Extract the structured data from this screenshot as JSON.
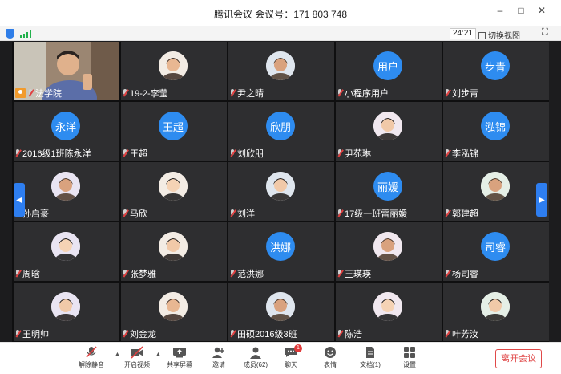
{
  "window": {
    "title": "腾讯会议 会议号：171 803 748",
    "minimize": "–",
    "maximize": "□",
    "close": "✕"
  },
  "infobar": {
    "timer": "24:21",
    "switch_view": "切换视图",
    "fullscreen": "⛶"
  },
  "colors": {
    "accent": "#2e8cf0",
    "leave": "#e04848",
    "tile_bg": "#2e2e30"
  },
  "participants": [
    {
      "name": "法学院",
      "type": "video"
    },
    {
      "name": "19-2-李莹",
      "type": "photo"
    },
    {
      "name": "尹之晴",
      "type": "photo"
    },
    {
      "name": "小程序用户",
      "type": "avatar",
      "avatar": "用户"
    },
    {
      "name": "刘步青",
      "type": "avatar",
      "avatar": "步青"
    },
    {
      "name": "2016级1班陈永洋",
      "type": "avatar",
      "avatar": "永洋"
    },
    {
      "name": "王超",
      "type": "avatar",
      "avatar": "王超"
    },
    {
      "name": "刘欣朋",
      "type": "avatar",
      "avatar": "欣朋"
    },
    {
      "name": "尹苑琳",
      "type": "photo"
    },
    {
      "name": "李泓锦",
      "type": "avatar",
      "avatar": "泓锦"
    },
    {
      "name": "孙启豪",
      "type": "photo"
    },
    {
      "name": "马欣",
      "type": "photo"
    },
    {
      "name": "刘洋",
      "type": "photo"
    },
    {
      "name": "17级一班雷丽媛",
      "type": "avatar",
      "avatar": "丽媛"
    },
    {
      "name": "郭建超",
      "type": "photo"
    },
    {
      "name": "周晗",
      "type": "photo"
    },
    {
      "name": "张梦雅",
      "type": "photo"
    },
    {
      "name": "范洪娜",
      "type": "avatar",
      "avatar": "洪娜"
    },
    {
      "name": "王瑛瑛",
      "type": "photo"
    },
    {
      "name": "杨司睿",
      "type": "avatar",
      "avatar": "司睿"
    },
    {
      "name": "王明帅",
      "type": "photo"
    },
    {
      "name": "刘金龙",
      "type": "photo"
    },
    {
      "name": "田硕2016级3班",
      "type": "photo"
    },
    {
      "name": "陈浩",
      "type": "photo"
    },
    {
      "name": "叶芳汝",
      "type": "photo"
    }
  ],
  "toolbar": {
    "unmute": "解除静音",
    "start_video": "开启视频",
    "share_screen": "共享屏幕",
    "invite": "邀请",
    "members": "成员(62)",
    "chat": "聊天",
    "chat_badge": "1",
    "reactions": "表情",
    "docs": "文档(1)",
    "settings": "设置",
    "leave": "离开会议"
  }
}
